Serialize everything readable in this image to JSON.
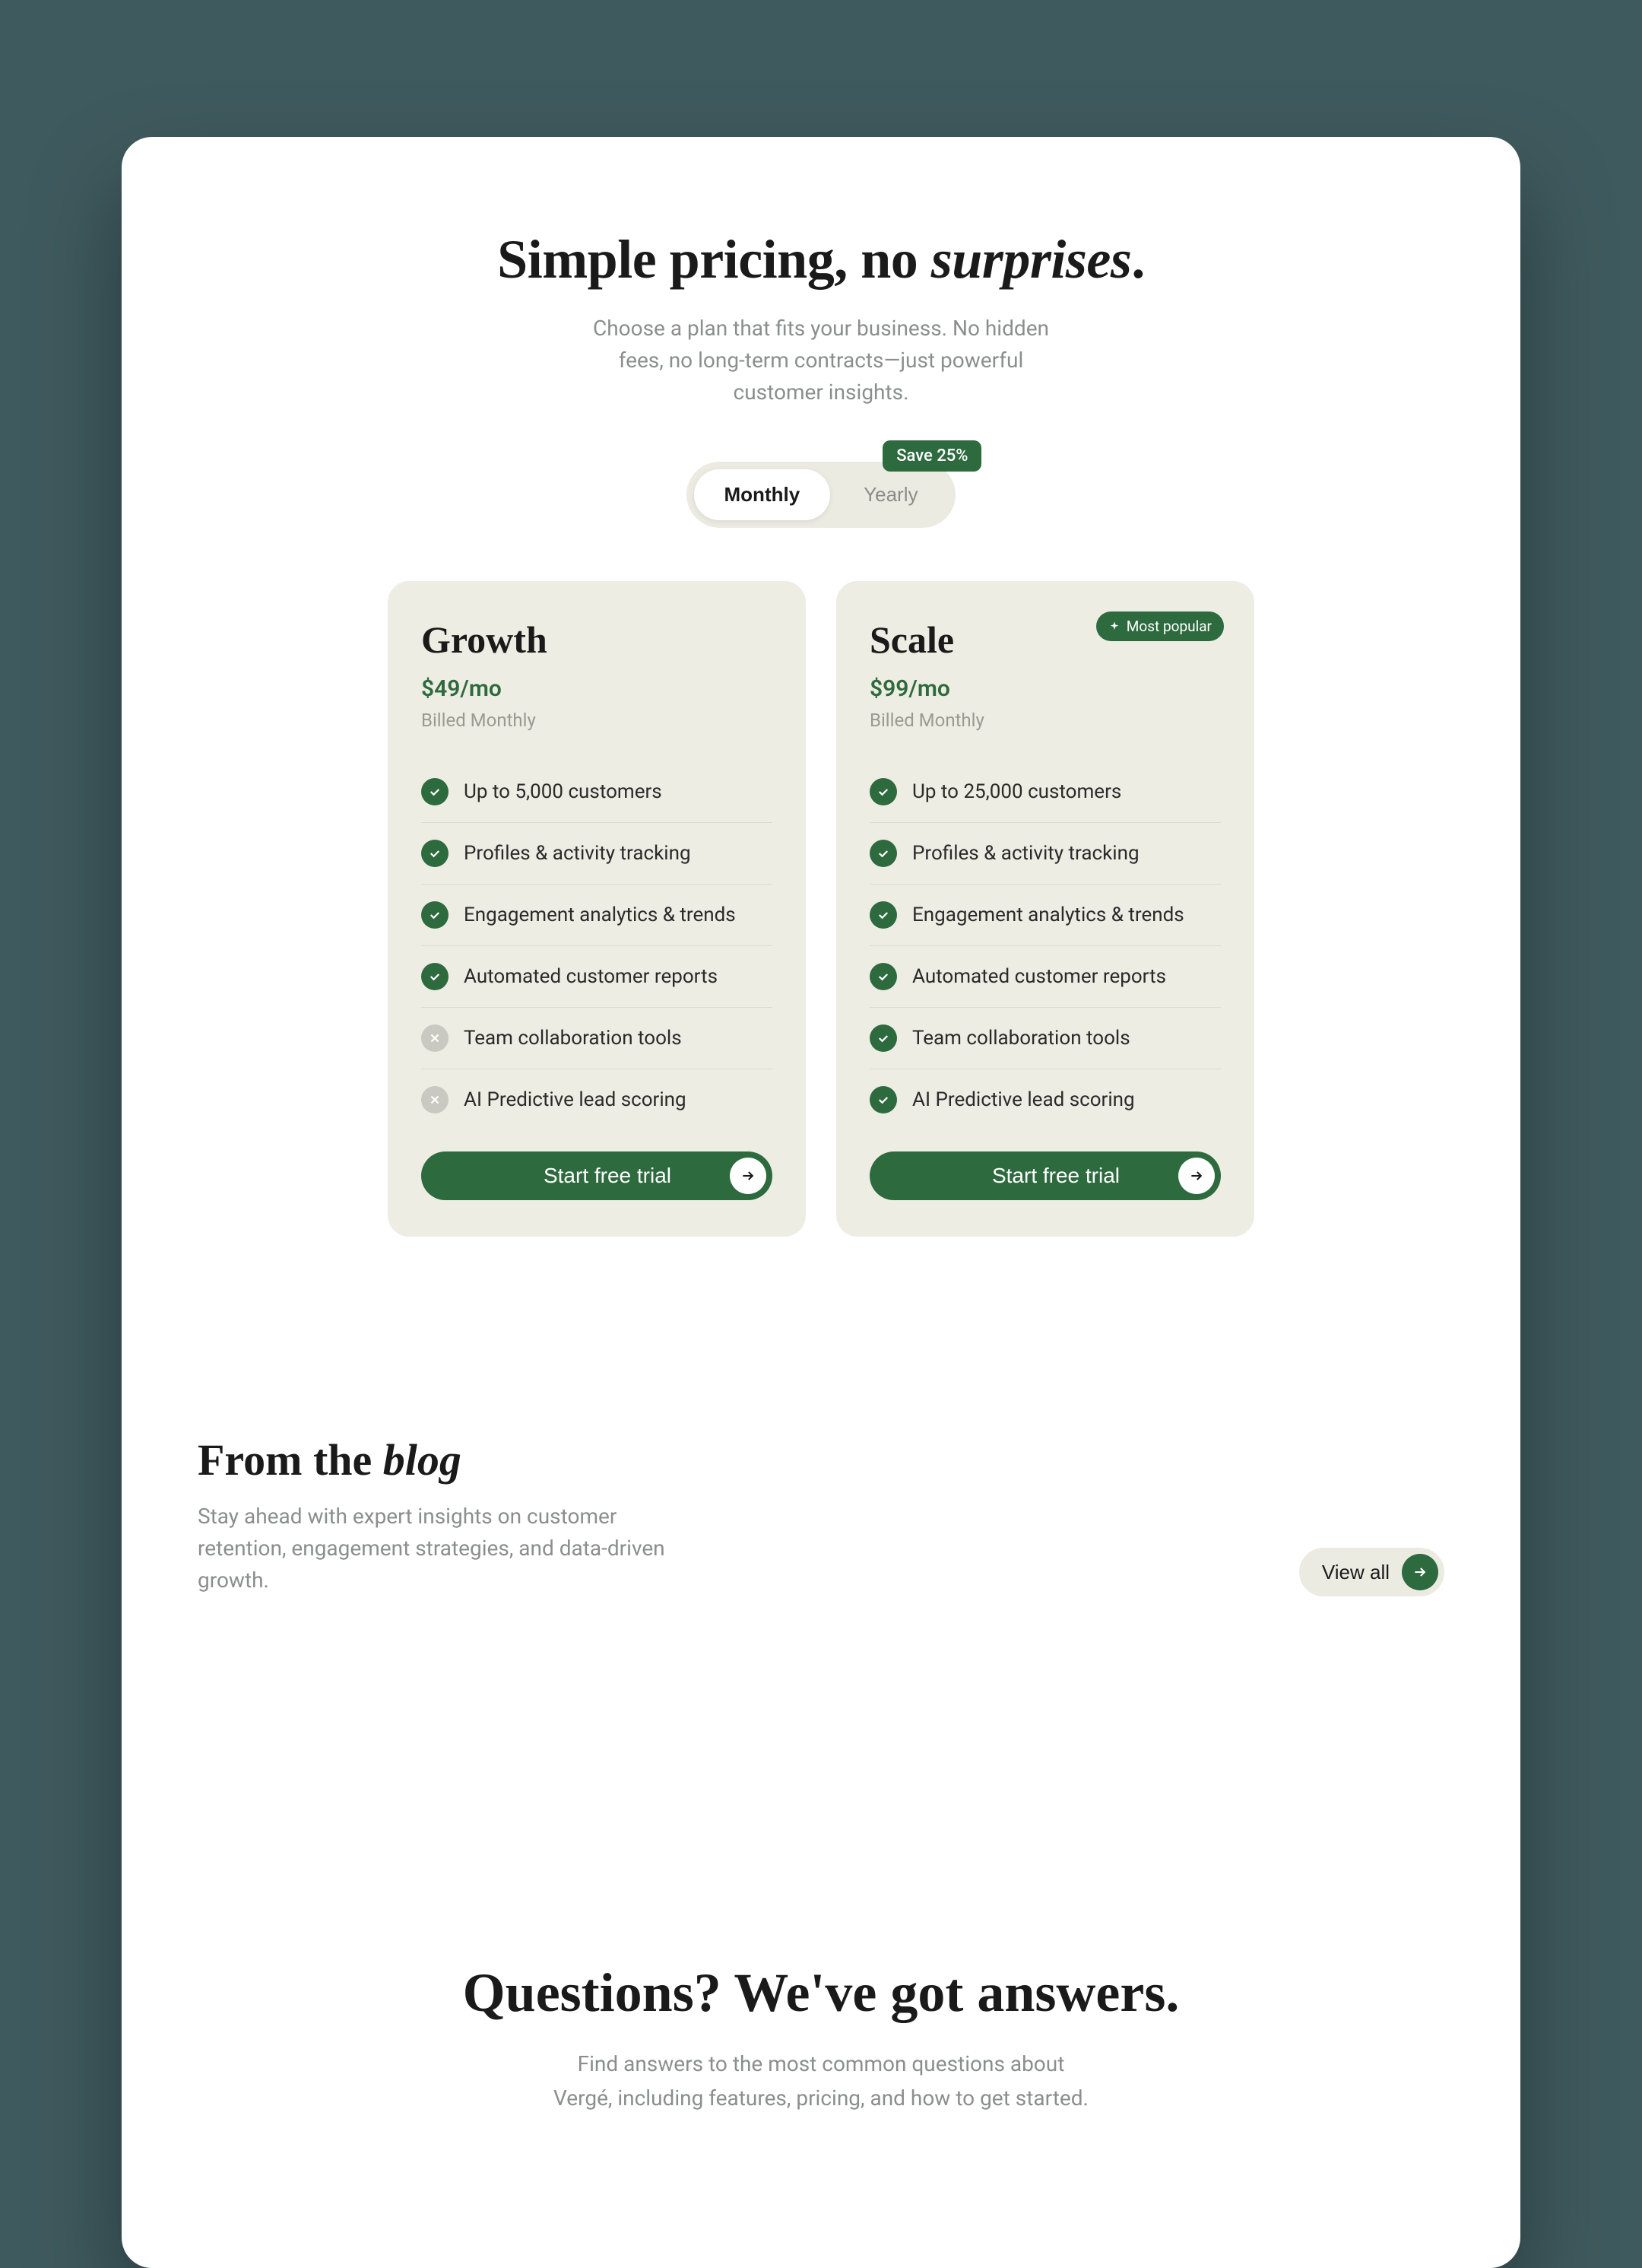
{
  "pricing": {
    "title_pre": "Simple pricing, no ",
    "title_italic": "surprises",
    "title_post": ".",
    "subtitle": "Choose a plan that fits your business. No hidden fees, no long-term contracts—just powerful customer insights.",
    "toggle": {
      "monthly": "Monthly",
      "yearly": "Yearly",
      "save_badge": "Save 25%"
    },
    "plans": [
      {
        "name": "Growth",
        "price": "$49/mo",
        "billed": "Billed Monthly",
        "popular": false,
        "features": [
          {
            "label": "Up to 5,000 customers",
            "included": true
          },
          {
            "label": "Profiles & activity tracking",
            "included": true
          },
          {
            "label": "Engagement analytics & trends",
            "included": true
          },
          {
            "label": "Automated customer reports",
            "included": true
          },
          {
            "label": "Team collaboration tools",
            "included": false
          },
          {
            "label": "AI Predictive lead scoring",
            "included": false
          }
        ],
        "cta": "Start free trial"
      },
      {
        "name": "Scale",
        "price": "$99/mo",
        "billed": "Billed Monthly",
        "popular": true,
        "popular_label": "Most popular",
        "features": [
          {
            "label": "Up to 25,000 customers",
            "included": true
          },
          {
            "label": "Profiles & activity tracking",
            "included": true
          },
          {
            "label": "Engagement analytics & trends",
            "included": true
          },
          {
            "label": "Automated customer reports",
            "included": true
          },
          {
            "label": "Team collaboration tools",
            "included": true
          },
          {
            "label": "AI Predictive lead scoring",
            "included": true
          }
        ],
        "cta": "Start free trial"
      }
    ]
  },
  "blog": {
    "title_pre": "From the ",
    "title_italic": "blog",
    "subtitle": "Stay ahead with expert insights on customer retention, engagement strategies, and data-driven growth.",
    "view_all": "View all"
  },
  "faq": {
    "title": "Questions? We've got answers.",
    "subtitle": "Find answers to the most common questions about Vergé, including features, pricing, and how to get started."
  },
  "colors": {
    "accent": "#2d6a3e",
    "panel": "#eeede4",
    "bg": "#3f5a5e"
  }
}
